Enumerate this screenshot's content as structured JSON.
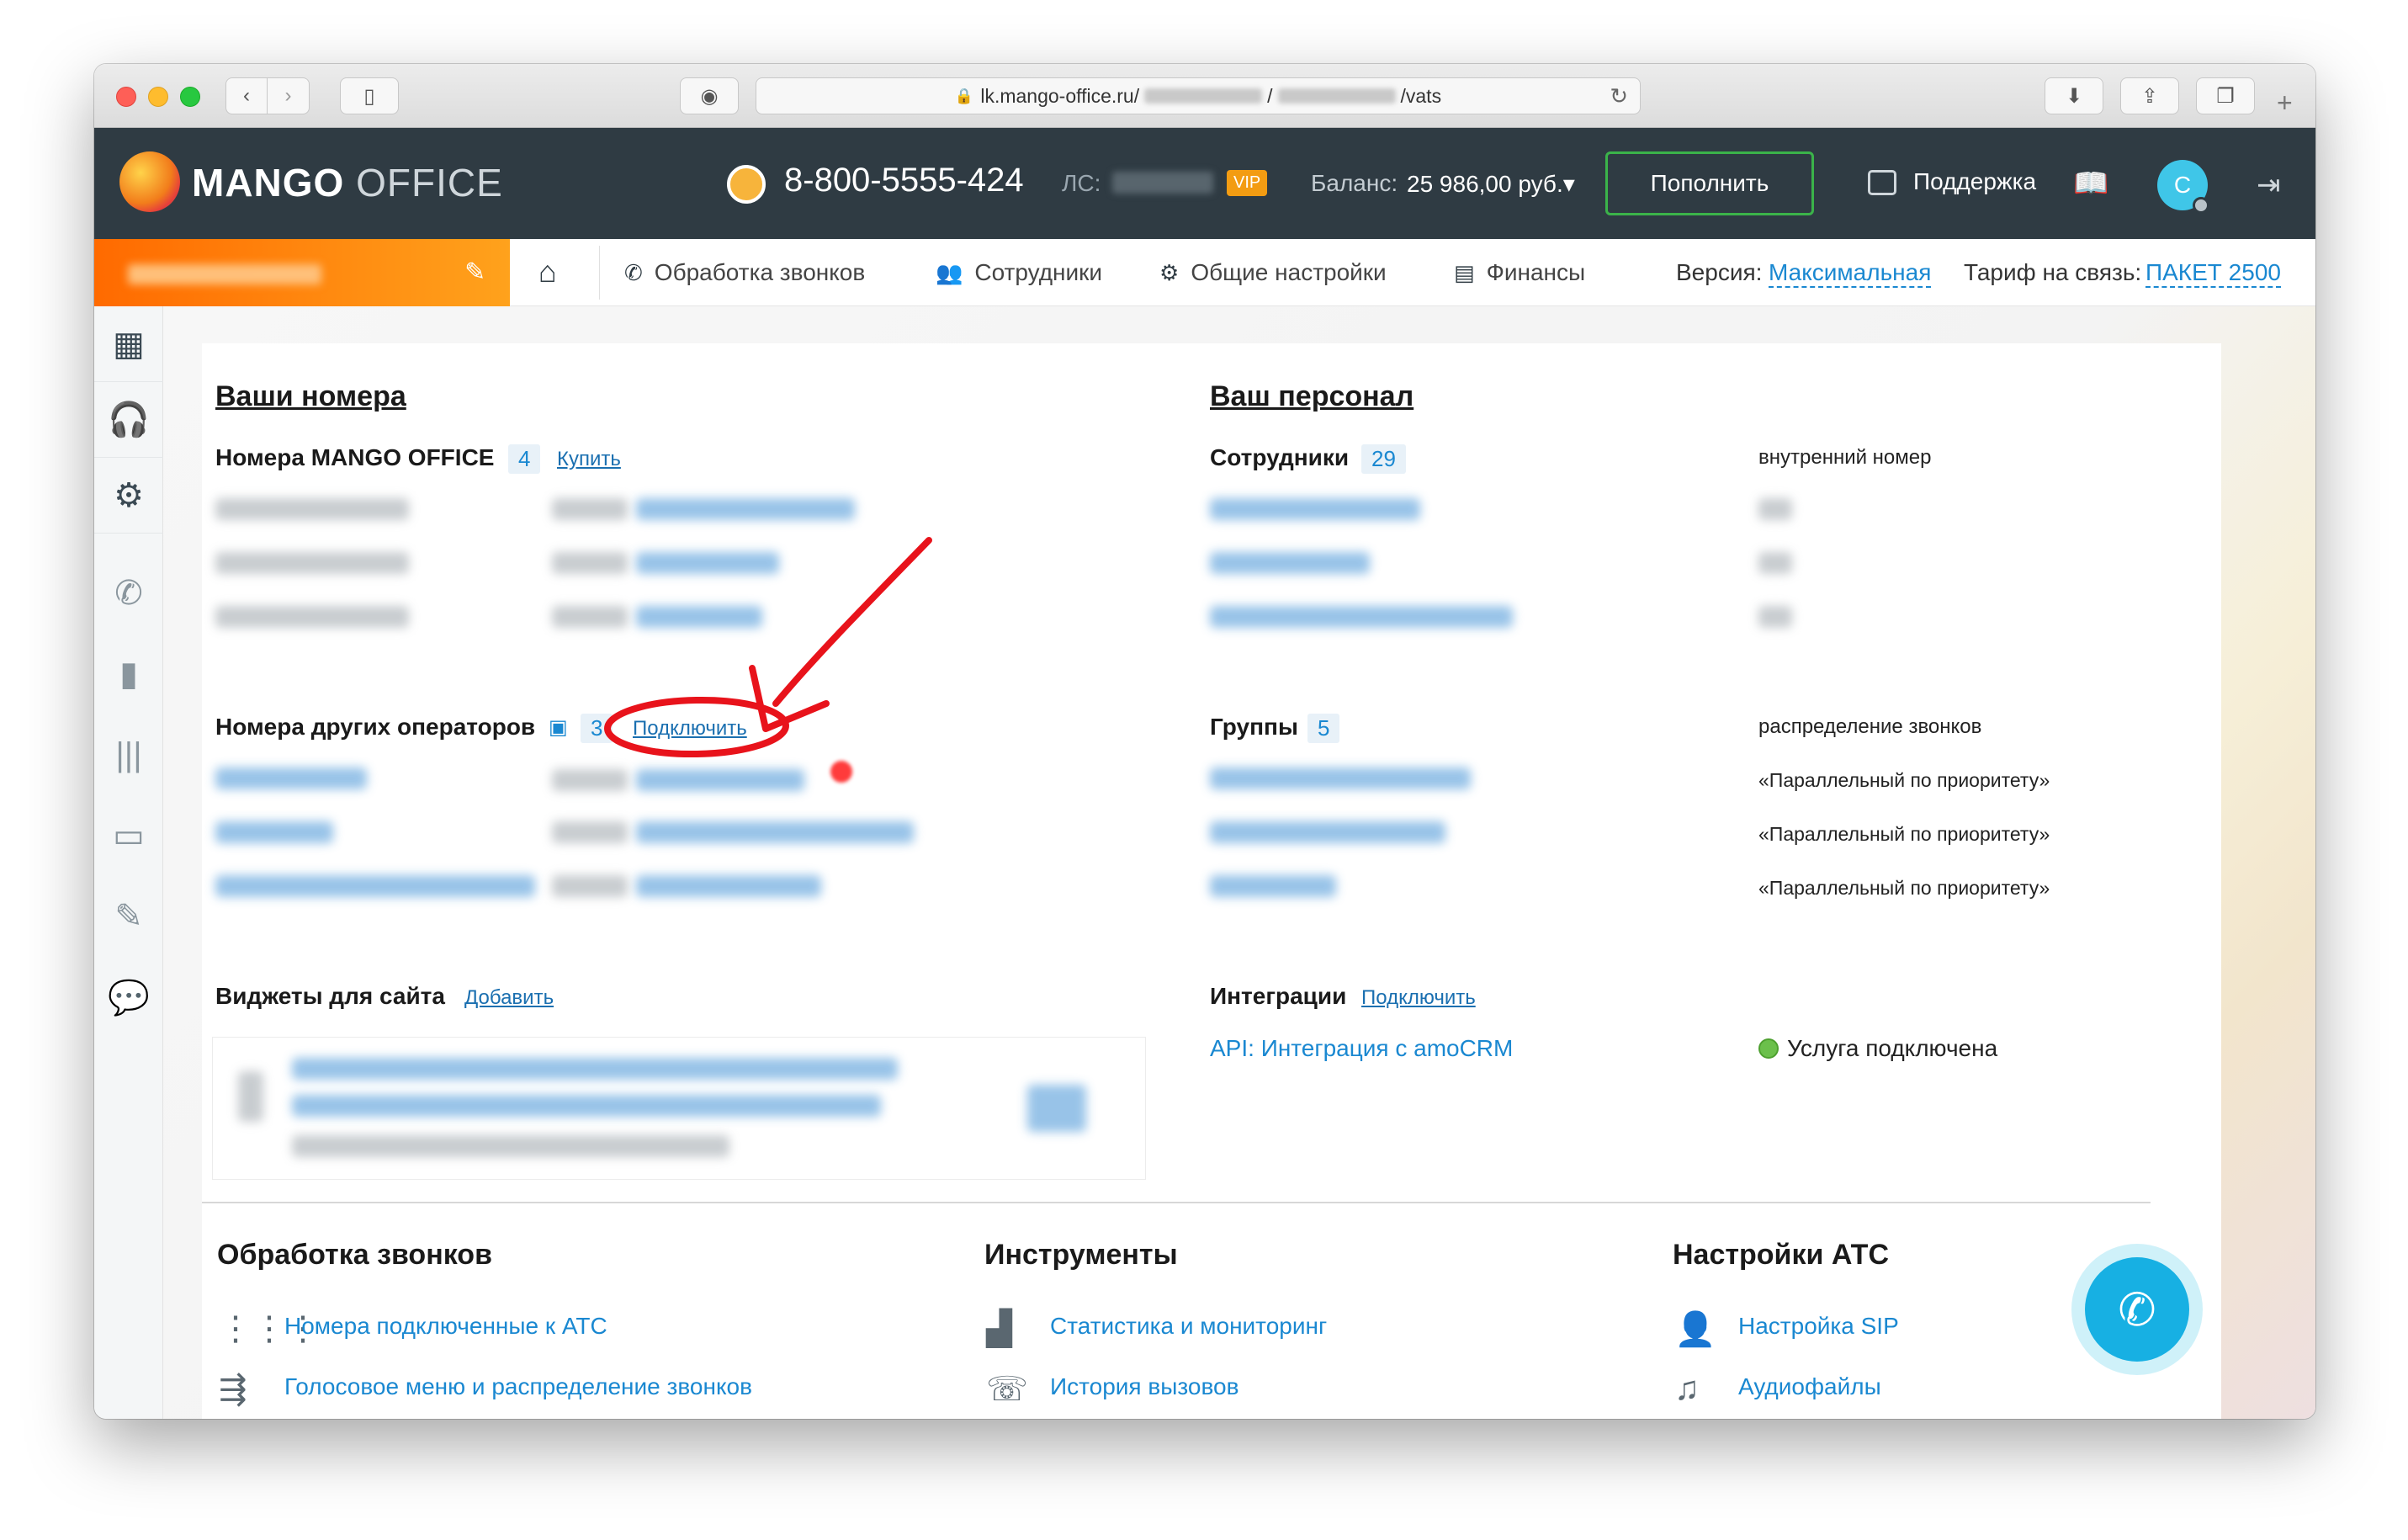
{
  "browser": {
    "url_domain": "lk.mango-office.ru/",
    "url_sep": "/",
    "url_tail": "/vats"
  },
  "header": {
    "logo_bold": "MANGO",
    "logo_light": " OFFICE",
    "phone": "8-800-5555-424",
    "ls_label": "ЛС:",
    "vip": "VIP",
    "balance_label": "Баланс:",
    "balance_value": "25 986,00 руб.▾",
    "topup_label": "Пополнить",
    "support_label": "Поддержка",
    "avatar_letter": "C"
  },
  "nav": {
    "items": [
      {
        "label": "Обработка звонков",
        "icon": "phone-icon"
      },
      {
        "label": "Сотрудники",
        "icon": "users-icon"
      },
      {
        "label": "Общие настройки",
        "icon": "gear-icon"
      },
      {
        "label": "Финансы",
        "icon": "wallet-icon"
      }
    ],
    "version_label": "Версия:",
    "version_value": "Максимальная",
    "tariff_label": "Тариф на связь:",
    "tariff_value": "ПАКЕТ 2500"
  },
  "numbers": {
    "title": "Ваши номера",
    "mango_label": "Номера MANGO OFFICE",
    "mango_count": "4",
    "buy_link": "Купить",
    "other_label": "Номера других операторов",
    "other_count": "3",
    "connect_link": "Подключить"
  },
  "staff": {
    "title": "Ваш персонал",
    "employees_label": "Сотрудники",
    "employees_count": "29",
    "internal_header": "внутренний номер",
    "groups_label": "Группы",
    "groups_count": "5",
    "distribution_header": "распределение звонков",
    "distribution_values": [
      "«Параллельный по приоритету»",
      "«Параллельный по приоритету»",
      "«Параллельный по приоритету»"
    ]
  },
  "widgets": {
    "label": "Виджеты для сайта",
    "add_link": "Добавить"
  },
  "integrations": {
    "label": "Интеграции",
    "connect_link": "Подключить",
    "item": "API: Интеграция с amoCRM",
    "status": "Услуга подключена"
  },
  "bottom": {
    "calls": {
      "title": "Обработка звонков",
      "links": [
        "Номера подключенные к АТС",
        "Голосовое меню и распределение звонков"
      ]
    },
    "tools": {
      "title": "Инструменты",
      "links": [
        "Статистика и мониторинг",
        "История вызовов"
      ]
    },
    "pbx": {
      "title": "Настройки АТС",
      "links": [
        "Настройка SIP",
        "Аудиофайлы"
      ]
    }
  },
  "colors": {
    "header_bg": "#2f3b43",
    "accent_orange": "#ff6a00",
    "link_blue": "#1a88d1",
    "annotation_red": "#e8131b",
    "fab_blue": "#17b0e3"
  }
}
